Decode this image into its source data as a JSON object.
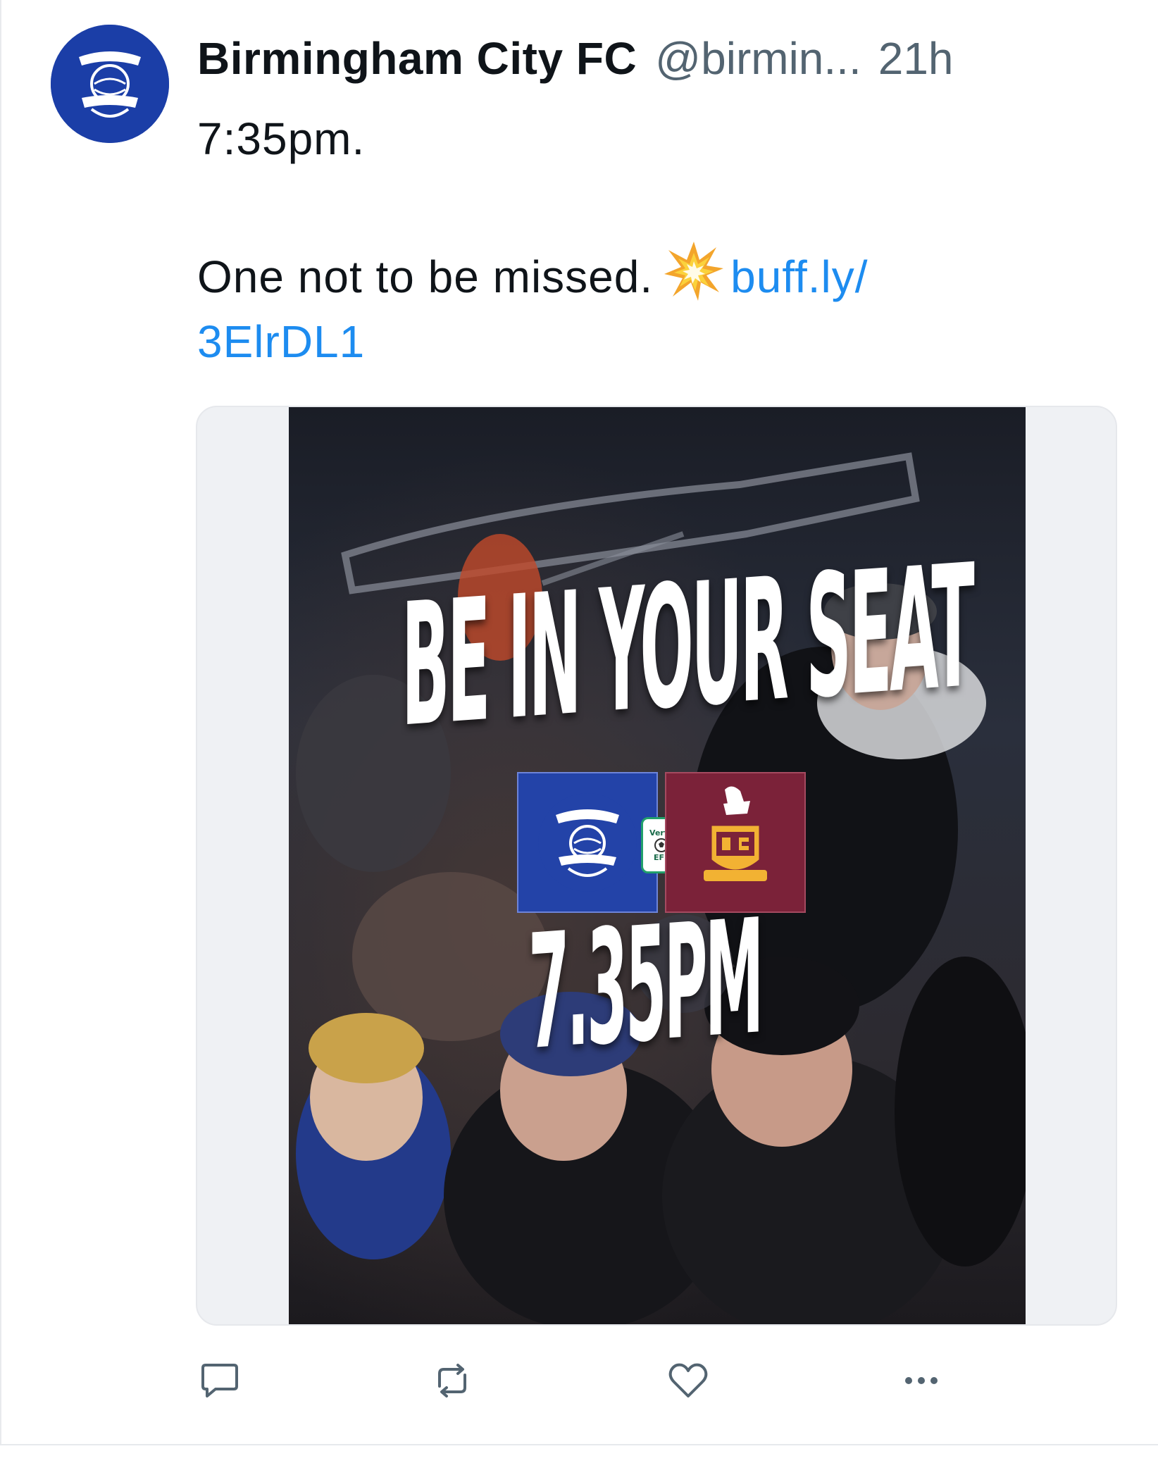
{
  "tweet": {
    "author": {
      "display_name": "Birmingham City FC",
      "handle": "@birmin...",
      "avatar_icon": "birmingham-city-crest-icon"
    },
    "timestamp": "21h",
    "text": {
      "line1": "7:35pm.",
      "line2_text": "One not to be missed.",
      "line2_emoji": "collision-emoji",
      "link_part1": "buff.ly/",
      "link_part2": "3ElrDL1"
    },
    "media": {
      "headline": "BE IN YOUR SEAT",
      "home_crest_icon": "birmingham-city-crest-icon",
      "competition_badge": "Vertu",
      "competition_sub": "EFL",
      "away_crest_icon": "bradford-city-crest-icon",
      "kickoff": "7.35PM"
    },
    "actions": [
      {
        "name": "reply",
        "icon": "reply-icon"
      },
      {
        "name": "retweet",
        "icon": "retweet-icon"
      },
      {
        "name": "like",
        "icon": "heart-icon"
      },
      {
        "name": "more",
        "icon": "more-options-icon"
      }
    ]
  },
  "colors": {
    "text_primary": "#0f1419",
    "text_secondary": "#536471",
    "link": "#1d8cf0",
    "club_blue": "#1b3ea7",
    "away_claret": "#7b2239",
    "icon_gray": "#536471"
  }
}
